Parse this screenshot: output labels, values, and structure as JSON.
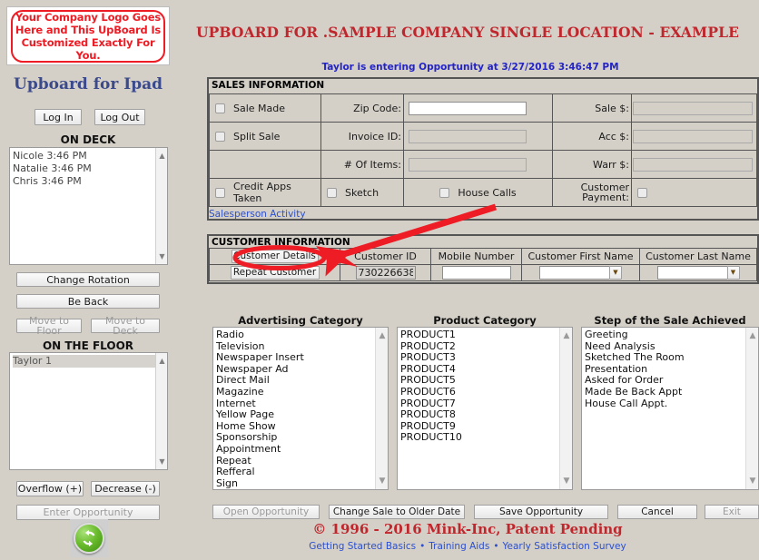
{
  "logo": {
    "line1": "Your Company Logo Goes",
    "line2": "Here and This UpBoard Is",
    "line3": "Customized Exactly For You.",
    "color": "#ee1c24"
  },
  "sidebar": {
    "brand": "Upboard for Ipad",
    "login_label": "Log In",
    "logout_label": "Log Out",
    "on_deck_title": "ON DECK",
    "on_deck_items": [
      "Nicole 3:46 PM",
      "Natalie 3:46 PM",
      "Chris 3:46 PM"
    ],
    "change_rotation_label": "Change Rotation",
    "be_back_label": "Be Back",
    "move_to_floor_label": "Move to Floor",
    "move_to_deck_label": "Move to Deck",
    "on_floor_title": "ON THE FLOOR",
    "on_floor_items": [
      "Taylor 1"
    ],
    "overflow_label": "Overflow (+)",
    "decrease_label": "Decrease (-)",
    "enter_opportunity_label": "Enter Opportunity",
    "refresh_icon": "refresh-icon"
  },
  "header": {
    "title": "UPBOARD FOR .SAMPLE COMPANY SINGLE LOCATION - EXAMPLE",
    "title_color": "#c0272d",
    "status": "Taylor is entering Opportunity at 3/27/2016 3:46:47 PM",
    "status_color": "#2323c8"
  },
  "sales_information": {
    "panel_label": "SALES INFORMATION",
    "sale_made_label": "Sale Made",
    "sale_made_checked": false,
    "split_sale_label": "Split Sale",
    "split_sale_checked": false,
    "credit_apps_label": "Credit Apps Taken",
    "credit_apps_checked": false,
    "sketch_label": "Sketch",
    "sketch_checked": false,
    "house_calls_label": "House Calls",
    "house_calls_checked": false,
    "zip_code_label": "Zip Code:",
    "zip_code_value": "",
    "invoice_id_label": "Invoice ID:",
    "invoice_id_value": "",
    "num_items_label": "# Of Items:",
    "num_items_value": "",
    "sale_dollars_label": "Sale $:",
    "sale_dollars_value": "",
    "acc_dollars_label": "Acc $:",
    "acc_dollars_value": "",
    "warr_dollars_label": "Warr $:",
    "warr_dollars_value": "",
    "customer_payment_label_1": "Customer",
    "customer_payment_label_2": "Payment:",
    "customer_payment_checked": false,
    "salesperson_activity_link": "Salesperson Activity"
  },
  "customer_information": {
    "panel_label": "CUSTOMER INFORMATION",
    "customer_details_label": "Customer Details",
    "repeat_customer_label": "Repeat Customer",
    "headers": [
      "Customer ID",
      "Mobile Number",
      "Customer First Name",
      "Customer Last Name"
    ],
    "customer_id_value": "730226638",
    "mobile_number_value": "",
    "first_name_value": "",
    "last_name_value": "",
    "dropdown_icon": "chevron-down-icon"
  },
  "lists": {
    "advertising_title": "Advertising Category",
    "advertising_items": [
      "Radio",
      "Television",
      "Newspaper Insert",
      "Newspaper Ad",
      "Direct Mail",
      "Magazine",
      "Internet",
      "Yellow Page",
      "Home Show",
      "Sponsorship",
      "Appointment",
      "Repeat",
      "Refferal",
      "Sign"
    ],
    "product_title": "Product Category",
    "product_items": [
      "PRODUCT1",
      "PRODUCT2",
      "PRODUCT3",
      "PRODUCT4",
      "PRODUCT5",
      "PRODUCT6",
      "PRODUCT7",
      "PRODUCT8",
      "PRODUCT9",
      "PRODUCT10"
    ],
    "step_title": "Step of the Sale Achieved",
    "step_items": [
      "Greeting",
      "Need Analysis",
      "Sketched The Room",
      "Presentation",
      "Asked for Order",
      "Made Be Back Appt",
      "House Call Appt."
    ]
  },
  "bottom_buttons": {
    "open_opportunity": "Open Opportunity",
    "change_sale_to_older_date": "Change  Sale to Older Date",
    "save_opportunity": "Save Opportunity",
    "cancel": "Cancel",
    "exit": "Exit"
  },
  "footer": {
    "copyright": "© 1996 - 2016 Mink-Inc, Patent Pending",
    "links": [
      "Getting Started Basics",
      "Training Aids",
      "Yearly Satisfaction Survey"
    ],
    "separator": "•",
    "link_color": "#2b4fd0"
  },
  "annotation": {
    "highlight_color": "#ee1c24",
    "arrow_target": "Customer Details"
  }
}
